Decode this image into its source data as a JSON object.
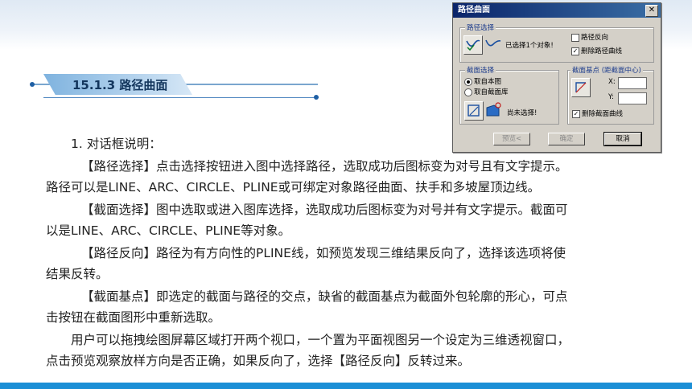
{
  "section": {
    "title": "15.1.3 路径曲面"
  },
  "body": {
    "lines": [
      "1. 对话框说明：",
      "【路径选择】点击选择按钮进入图中选择路径，选取成功后图标变为对号且有文字提示。",
      "路径可以是LINE、ARC、CIRCLE、PLINE或可绑定对象路径曲面、扶手和多坡屋顶边线。",
      "【截面选择】图中选取或进入图库选择，选取成功后图标变为对号并有文字提示。截面可",
      "以是LINE、ARC、CIRCLE、PLINE等对象。",
      "【路径反向】路径为有方向性的PLINE线，如预览发现三维结果反向了，选择该选项将使",
      "结果反转。",
      "【截面基点】即选定的截面与路径的交点，缺省的截面基点为截面外包轮廓的形心，可点",
      "击按钮在截面图形中重新选取。",
      "用户可以拖拽绘图屏幕区域打开两个视口，一个置为平面视图另一个设定为三维透视窗口，",
      "点击预览观察放样方向是否正确，如果反向了，选择【路径反向】反转过来。"
    ]
  },
  "dialog": {
    "title": "路径曲面",
    "close_symbol": "✕",
    "path_group": {
      "label": "路径选择",
      "status": "已选择1个对象!",
      "reverse_label": "路径反向",
      "delete_path_label": "删除路径曲线",
      "reverse_checked": false,
      "delete_checked": true
    },
    "section_group": {
      "label": "截面选择",
      "from_drawing": "取自本图",
      "from_library": "取自截面库",
      "status": "尚未选择!",
      "selected_source": "from_drawing"
    },
    "base_group": {
      "label": "截面基点 (距截面中心)",
      "x_label": "X:",
      "y_label": "Y:",
      "x_value": "",
      "y_value": "",
      "delete_section_label": "删除截面曲线",
      "delete_checked": true
    },
    "buttons": {
      "preview": "预览<",
      "ok": "确定",
      "cancel": "取消"
    },
    "check_mark": "✓"
  }
}
